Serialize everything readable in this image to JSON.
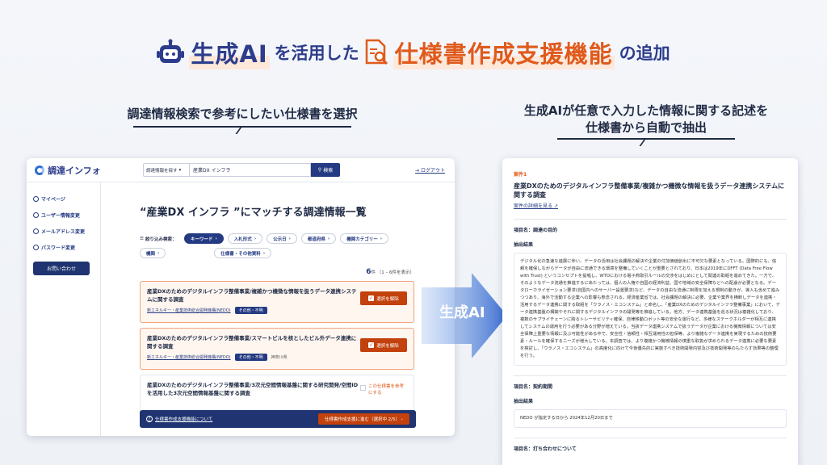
{
  "hero": {
    "part1": "生成AI",
    "part2": "を活用した",
    "part3": "仕様書作成支援機能",
    "part4": "の追加",
    "icons": [
      "robot-icon",
      "document-search-icon"
    ]
  },
  "captions": {
    "left": "調達情報検索で参考にしたい仕様書を選択",
    "right_line1": "生成AIが任意で入力した情報に関する記述を",
    "right_line2": "仕様書から自動で抽出"
  },
  "app": {
    "logo": "調達インフォ",
    "search": {
      "select": "調達情報を探す",
      "query": "産業DX インフラ",
      "button": "検索"
    },
    "logout": "ログアウト",
    "sidebar": [
      {
        "label": "マイページ",
        "icon": "home-icon"
      },
      {
        "label": "ユーザー情報変更",
        "icon": "user-icon"
      },
      {
        "label": "メールアドレス変更",
        "icon": "mail-icon"
      },
      {
        "label": "パスワード変更",
        "icon": "lock-icon"
      }
    ],
    "contact": "お問い合わせ",
    "heading": "“産業DX インフラ ”にマッチする調達情報一覧",
    "filter_label": "絞り込み検索：",
    "filters": [
      {
        "label": "キーワード",
        "active": true
      },
      {
        "label": "入札形式",
        "active": false
      },
      {
        "label": "公示日",
        "active": false
      },
      {
        "label": "都道府県",
        "active": false
      },
      {
        "label": "機関カテゴリー",
        "active": false
      },
      {
        "label": "機関",
        "active": false
      },
      {
        "label": "仕様書・その他資料",
        "active": false
      }
    ],
    "count_num": "6",
    "count_unit": "件",
    "count_range": "（1 – 6件を表示）",
    "cards": [
      {
        "title": "産業DXのためのデジタルインフラ整備事業/複雑かつ機微な情報を扱うデータ連携システムに関する調査",
        "org": "新エネルギー・産業技術総合開発機構(NEDO)",
        "tag": "その他・不明",
        "loc": "",
        "action": "選択を解除",
        "selected": true
      },
      {
        "title": "産業DXのためのデジタルインフラ整備事業/スマートビルを核としたビル外データ連携に関する調査",
        "org": "新エネルギー・産業技術総合開発機構(NEDO)",
        "tag": "その他・不明",
        "loc": "神奈川県",
        "action": "選択を解除",
        "selected": true
      },
      {
        "title": "産業DXのためのデジタルインフラ整備事業/3次元空間情報基盤に関する研究開発/空間IDを活用した3次元空間情報基盤に関する調査",
        "org": "",
        "tag": "",
        "loc": "",
        "action": "この仕様書を参考にする",
        "selected": false
      }
    ],
    "bottom_link": "仕様書作成支援機能について",
    "bottom_go": "仕様書作成支援に進む（選択中 2/5） ›"
  },
  "arrow_label": "生成AI",
  "doc": {
    "case": "案件1",
    "title": "産業DXのためのデジタルインフラ整備事業/複雑かつ機微な情報を扱うデータ連携システムに関する調査",
    "detail_link": "案件の詳細を見る",
    "sections": [
      {
        "item": "項目名：調達の目的",
        "sub": "抽出結果",
        "text": "デジタル化の急速な進展に伴い、データの活用は社会課題の解決や企業の付加価値創出に不可欠な要素となっている。国際的にも、信頼を確保しながらデータが自由に流通できる環境を整備していくことが重要とされており、日本は2019年にDFFT (Data Free Flow with Trust) というコンセプトを提唱し、WTOにおける電子商取引ルールの交渉をはじめにとして関連の取組を進めてきた。一方で、そのようなデータ流通を推進するにあたっては、個人の人権や自国の経済利益、国や地域の安全保障などへの配慮が必要となる。データローカライゼーション要求(自国内へのサーバー設置要求)など、データの自由な流通に制限を加える規制の動きが、導入も含めて進みつつあり、海外で活動する企業への影響も懸念される。経済産業省では、社会課題の解決に必要、企業や業界を横断しデータを連携・活用するデータ連携に関する取組を「ウラノス・エコシステム」と命名し、「産業DXのためのデジタルインフラ整備事業」において、データ連携基盤の構築やそれに関するデジタルインフラの開発等を推進している。他方、データ連携基盤を巡る状況は複雑化しており、複数のサプライチェーンに跨るトレーサビリティ確保、自律移動ロボット等の安全な運行など、多様なステークホルダーが相互に連携してシステムの運用を行う必要がある分野が増えている。当該データ連携システムで扱うデータが企業における機微情報については安全保障上重要な情報に及ぶ可能性がある中で、安全性・信頼性・相互運用性の担保等、より複雑なデータ連携を実現するための技術要素・ルールを確保するニーズが増大している。本調査では、より複雑かつ機微情報の慎重な取扱が求められるデータ連携に必要な要素を検討し、「ウラノス・エコシステム」の高度化に向けて今後優先的に実施すべき技術開発内容及び技術開発等のもたらす効果等の整理を行う。"
      },
      {
        "item": "項目名：契約期間",
        "sub": "抽出結果",
        "text": "NEDO が指定する日から 2024年12月20日まで"
      },
      {
        "item": "項目名：打ち合わせについて",
        "sub": "",
        "text": ""
      }
    ]
  }
}
